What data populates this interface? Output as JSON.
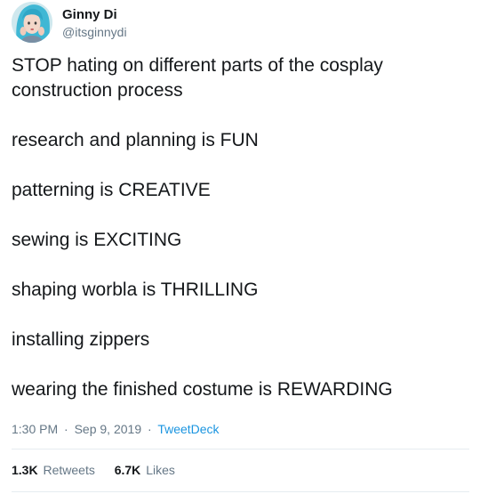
{
  "author": {
    "display_name": "Ginny Di",
    "handle": "@itsginnydi",
    "avatar_icon": "profile-photo-blue-hair"
  },
  "tweet": {
    "lines": [
      "STOP hating on different parts of the cosplay construction process",
      "research and planning is FUN",
      "patterning is CREATIVE",
      "sewing is EXCITING",
      "shaping worbla is THRILLING",
      "installing zippers",
      "wearing the finished costume is REWARDING"
    ]
  },
  "meta": {
    "time": "1:30 PM",
    "separator": "·",
    "date": "Sep 9, 2019",
    "source": "TweetDeck"
  },
  "stats": {
    "retweets_count": "1.3K",
    "retweets_label": "Retweets",
    "likes_count": "6.7K",
    "likes_label": "Likes"
  },
  "colors": {
    "text": "#14171a",
    "muted": "#657786",
    "link": "#1b95e0",
    "divider": "#e6ecf0"
  }
}
